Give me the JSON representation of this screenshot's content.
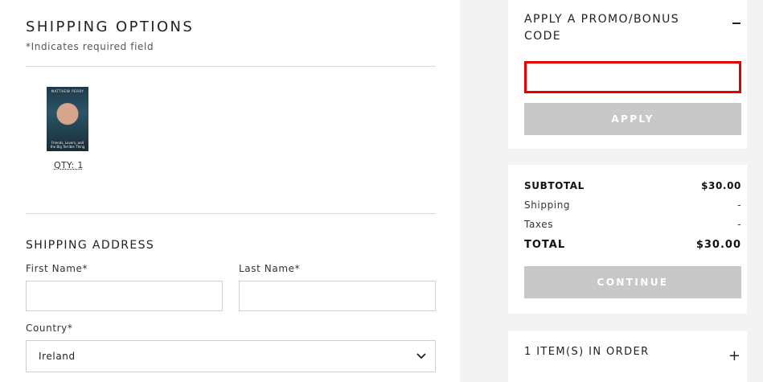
{
  "shipping": {
    "title": "SHIPPING OPTIONS",
    "required_note": "*Indicates required field",
    "item": {
      "cover_title": "MATTHEW PERRY",
      "cover_subtitle": "Friends, Lovers, and the Big Terrible Thing",
      "qty_label": "QTY: 1"
    }
  },
  "address": {
    "title": "SHIPPING ADDRESS",
    "first_name_label": "First Name*",
    "first_name_value": "",
    "last_name_label": "Last Name*",
    "last_name_value": "",
    "country_label": "Country*",
    "country_value": "Ireland"
  },
  "promo": {
    "title": "APPLY A PROMO/BONUS CODE",
    "input_value": "",
    "apply_label": "APPLY"
  },
  "summary": {
    "subtotal_label": "SUBTOTAL",
    "subtotal_value": "$30.00",
    "shipping_label": "Shipping",
    "shipping_value": "-",
    "taxes_label": "Taxes",
    "taxes_value": "-",
    "total_label": "TOTAL",
    "total_value": "$30.00",
    "continue_label": "CONTINUE"
  },
  "order": {
    "items_title": "1 ITEM(S) IN ORDER"
  },
  "colors": {
    "highlight_border": "#e00000",
    "disabled_button": "#c8c8c8",
    "panel_background": "#f3f3f3"
  }
}
